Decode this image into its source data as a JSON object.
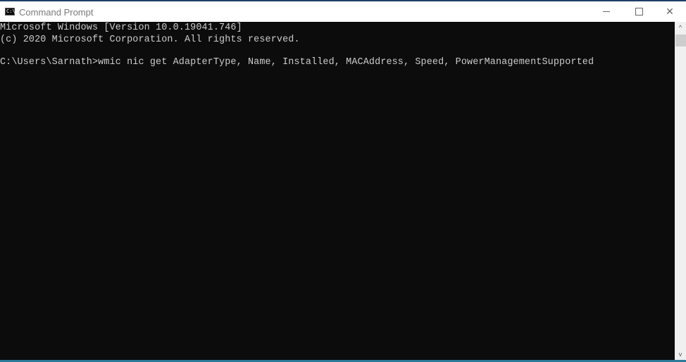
{
  "window": {
    "title": "Command Prompt",
    "icon": "cmd-icon",
    "icon_text": "C:\\.",
    "controls": [
      "minimize",
      "maximize",
      "close"
    ]
  },
  "console": {
    "lines": [
      "Microsoft Windows [Version 10.0.19041.746]",
      "(c) 2020 Microsoft Corporation. All rights reserved.",
      "C:\\Users\\Sarnath>wmic nic get AdapterType, Name, Installed, MACAddress, Speed, PowerManagementSupported"
    ],
    "colors": {
      "background": "#0c0c0c",
      "text": "#cccccc"
    }
  },
  "scrollbar": {
    "up_glyph": "^",
    "down_glyph": "v"
  },
  "close_glyph": "✕"
}
